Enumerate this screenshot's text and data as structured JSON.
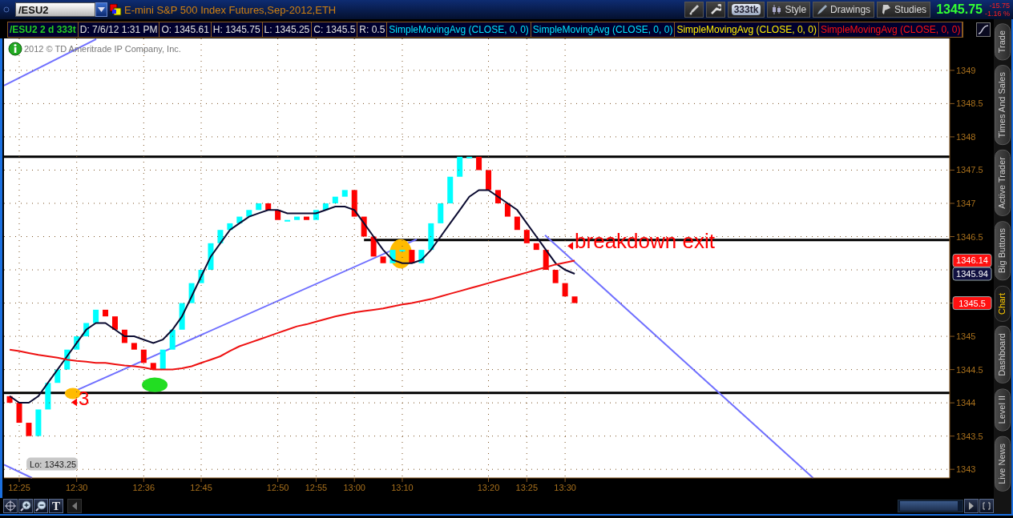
{
  "symbol_field": {
    "value": "/ESU2"
  },
  "title": "E-mini S&P 500 Index Futures,Sep-2012,ETH",
  "toolbar_buttons": [
    {
      "kind": "tick",
      "label": "333tk"
    },
    {
      "kind": "style",
      "label": "Style"
    },
    {
      "kind": "drawings",
      "label": "Drawings"
    },
    {
      "kind": "studies",
      "label": "Studies"
    }
  ],
  "quote": {
    "last": "1345.75",
    "change": "-15.75",
    "change_percent": "-1.16 %"
  },
  "info_bar": [
    {
      "text": "/ESU2 2 d 333t",
      "color": "#22cc22"
    },
    {
      "text": "D: 7/6/12 1:31 PM",
      "color": "#e0e0e0"
    },
    {
      "text": "O: 1345.61",
      "color": "#e0e0e0"
    },
    {
      "text": "H: 1345.75",
      "color": "#e0e0e0"
    },
    {
      "text": "L: 1345.25",
      "color": "#e0e0e0"
    },
    {
      "text": "C: 1345.5",
      "color": "#e0e0e0"
    },
    {
      "text": "R: 0.5",
      "color": "#e0e0e0"
    },
    {
      "text": "SimpleMovingAvg (CLOSE, 0, 0)",
      "color": "#00e5ff"
    },
    {
      "text": "SimpleMovingAvg (CLOSE, 0, 0)",
      "color": "#00e5ff"
    },
    {
      "text": "SimpleMovingAvg (CLOSE, 0, 0)",
      "color": "#ffee00"
    },
    {
      "text": "SimpleMovingAvg (CLOSE, 0, 0)",
      "color": "#ff1010"
    }
  ],
  "copyright": "2012 © TD Ameritrade IP Company, Inc.",
  "chart": {
    "chart_data": {
      "type": "line",
      "grid": true,
      "ylim": [
        1342.87,
        1349.48
      ],
      "categories": [
        null,
        "12:25",
        null,
        null,
        null,
        null,
        null,
        "12:30",
        null,
        null,
        null,
        null,
        null,
        null,
        "12:36",
        null,
        null,
        null,
        null,
        null,
        "12:45",
        null,
        null,
        null,
        null,
        null,
        null,
        null,
        "12:50",
        null,
        null,
        null,
        "12:55",
        null,
        null,
        null,
        "13:00",
        null,
        null,
        null,
        null,
        "13:10",
        null,
        null,
        null,
        null,
        null,
        null,
        null,
        null,
        "13:20",
        null,
        null,
        null,
        "13:25",
        null,
        null,
        null,
        "13:30",
        null
      ],
      "yticks": [
        1343,
        1343.5,
        1344,
        1344.5,
        1345,
        1345.5,
        1346.5,
        1347,
        1347.5,
        1348,
        1348.5,
        1349
      ],
      "series": [
        {
          "color": "#0a0a30",
          "values": [
            1344.1,
            1344.0,
            1344.0,
            1344.1,
            1344.3,
            1344.5,
            1344.7,
            1344.9,
            1345.1,
            1345.2,
            1345.2,
            1345.1,
            1345.0,
            1345.0,
            1344.95,
            1344.9,
            1344.95,
            1345.1,
            1345.3,
            1345.6,
            1345.9,
            1346.2,
            1346.4,
            1346.6,
            1346.7,
            1346.8,
            1346.85,
            1346.9,
            1346.9,
            1346.85,
            1346.85,
            1346.85,
            1346.85,
            1346.9,
            1346.95,
            1346.95,
            1346.9,
            1346.7,
            1346.5,
            1346.3,
            1346.15,
            1346.1,
            1346.1,
            1346.15,
            1346.3,
            1346.5,
            1346.7,
            1346.9,
            1347.1,
            1347.2,
            1347.2,
            1347.1,
            1347.0,
            1346.9,
            1346.7,
            1346.5,
            1346.3,
            1346.1,
            1346.0,
            1345.94
          ]
        },
        {
          "color": "#ee1111",
          "values": [
            1344.8,
            1344.78,
            1344.75,
            1344.72,
            1344.7,
            1344.68,
            1344.65,
            1344.63,
            1344.62,
            1344.6,
            1344.6,
            1344.58,
            1344.56,
            1344.55,
            1344.53,
            1344.5,
            1344.5,
            1344.5,
            1344.52,
            1344.55,
            1344.6,
            1344.65,
            1344.7,
            1344.78,
            1344.85,
            1344.9,
            1344.95,
            1345.0,
            1345.05,
            1345.1,
            1345.15,
            1345.18,
            1345.22,
            1345.26,
            1345.3,
            1345.33,
            1345.36,
            1345.38,
            1345.4,
            1345.42,
            1345.45,
            1345.48,
            1345.5,
            1345.53,
            1345.56,
            1345.6,
            1345.64,
            1345.68,
            1345.72,
            1345.76,
            1345.8,
            1345.84,
            1345.88,
            1345.92,
            1345.96,
            1346.0,
            1346.04,
            1346.08,
            1346.11,
            1346.14
          ]
        }
      ],
      "annotations": [
        "3",
        "breakdown exit"
      ]
    }
  },
  "low_label": "Lo: 1343.25",
  "price_tags": [
    {
      "label": "1346.14",
      "color": "#ff1010"
    },
    {
      "label": "1345.94",
      "color": "#101040"
    },
    {
      "label": "1345.5",
      "color": "#ff1010"
    }
  ],
  "side_tabs": [
    {
      "label": "Trade",
      "selected": false
    },
    {
      "label": "Times And Sales",
      "selected": false
    },
    {
      "label": "Active Trader",
      "selected": false
    },
    {
      "label": "Big Buttons",
      "selected": false
    },
    {
      "label": "Chart",
      "selected": true
    },
    {
      "label": "Dashboard",
      "selected": false
    },
    {
      "label": "Level II",
      "selected": false
    },
    {
      "label": "Live News",
      "selected": false
    }
  ],
  "bottom_toolbar": {
    "text_tool": "T"
  }
}
